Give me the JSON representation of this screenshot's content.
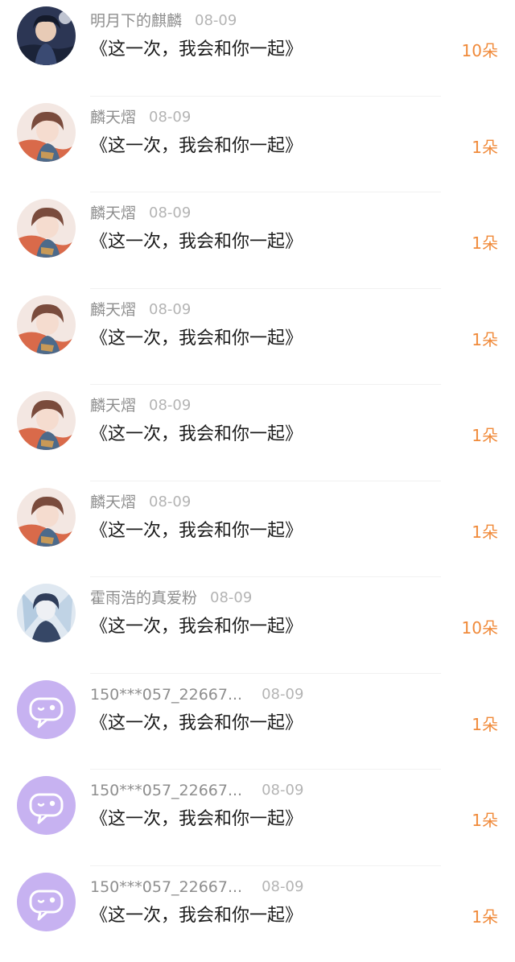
{
  "gifts": [
    {
      "name": "明月下的麒麟",
      "date": "08-09",
      "title": "《这一次，我会和你一起》",
      "count": "10朵",
      "avatar": "avatar-dark-boy"
    },
    {
      "name": "麟天熠",
      "date": "08-09",
      "title": "《这一次，我会和你一起》",
      "count": "1朵",
      "avatar": "avatar-anime-boy"
    },
    {
      "name": "麟天熠",
      "date": "08-09",
      "title": "《这一次，我会和你一起》",
      "count": "1朵",
      "avatar": "avatar-anime-boy"
    },
    {
      "name": "麟天熠",
      "date": "08-09",
      "title": "《这一次，我会和你一起》",
      "count": "1朵",
      "avatar": "avatar-anime-boy"
    },
    {
      "name": "麟天熠",
      "date": "08-09",
      "title": "《这一次，我会和你一起》",
      "count": "1朵",
      "avatar": "avatar-anime-boy"
    },
    {
      "name": "麟天熠",
      "date": "08-09",
      "title": "《这一次，我会和你一起》",
      "count": "1朵",
      "avatar": "avatar-anime-boy"
    },
    {
      "name": "霍雨浩的真爱粉",
      "date": "08-09",
      "title": "《这一次，我会和你一起》",
      "count": "10朵",
      "avatar": "avatar-ice-boy"
    },
    {
      "name": "150***057_22667...",
      "date": "08-09",
      "title": "《这一次，我会和你一起》",
      "count": "1朵",
      "avatar": "default-chat-avatar-icon"
    },
    {
      "name": "150***057_22667...",
      "date": "08-09",
      "title": "《这一次，我会和你一起》",
      "count": "1朵",
      "avatar": "default-chat-avatar-icon"
    },
    {
      "name": "150***057_22667...",
      "date": "08-09",
      "title": "《这一次，我会和你一起》",
      "count": "1朵",
      "avatar": "default-chat-avatar-icon"
    }
  ],
  "colors": {
    "count": "#f08a3a",
    "name": "#8e8e8e",
    "date": "#b4b4b4",
    "title": "#1c1c1c",
    "default_avatar_bg": "#c7b2f1"
  }
}
